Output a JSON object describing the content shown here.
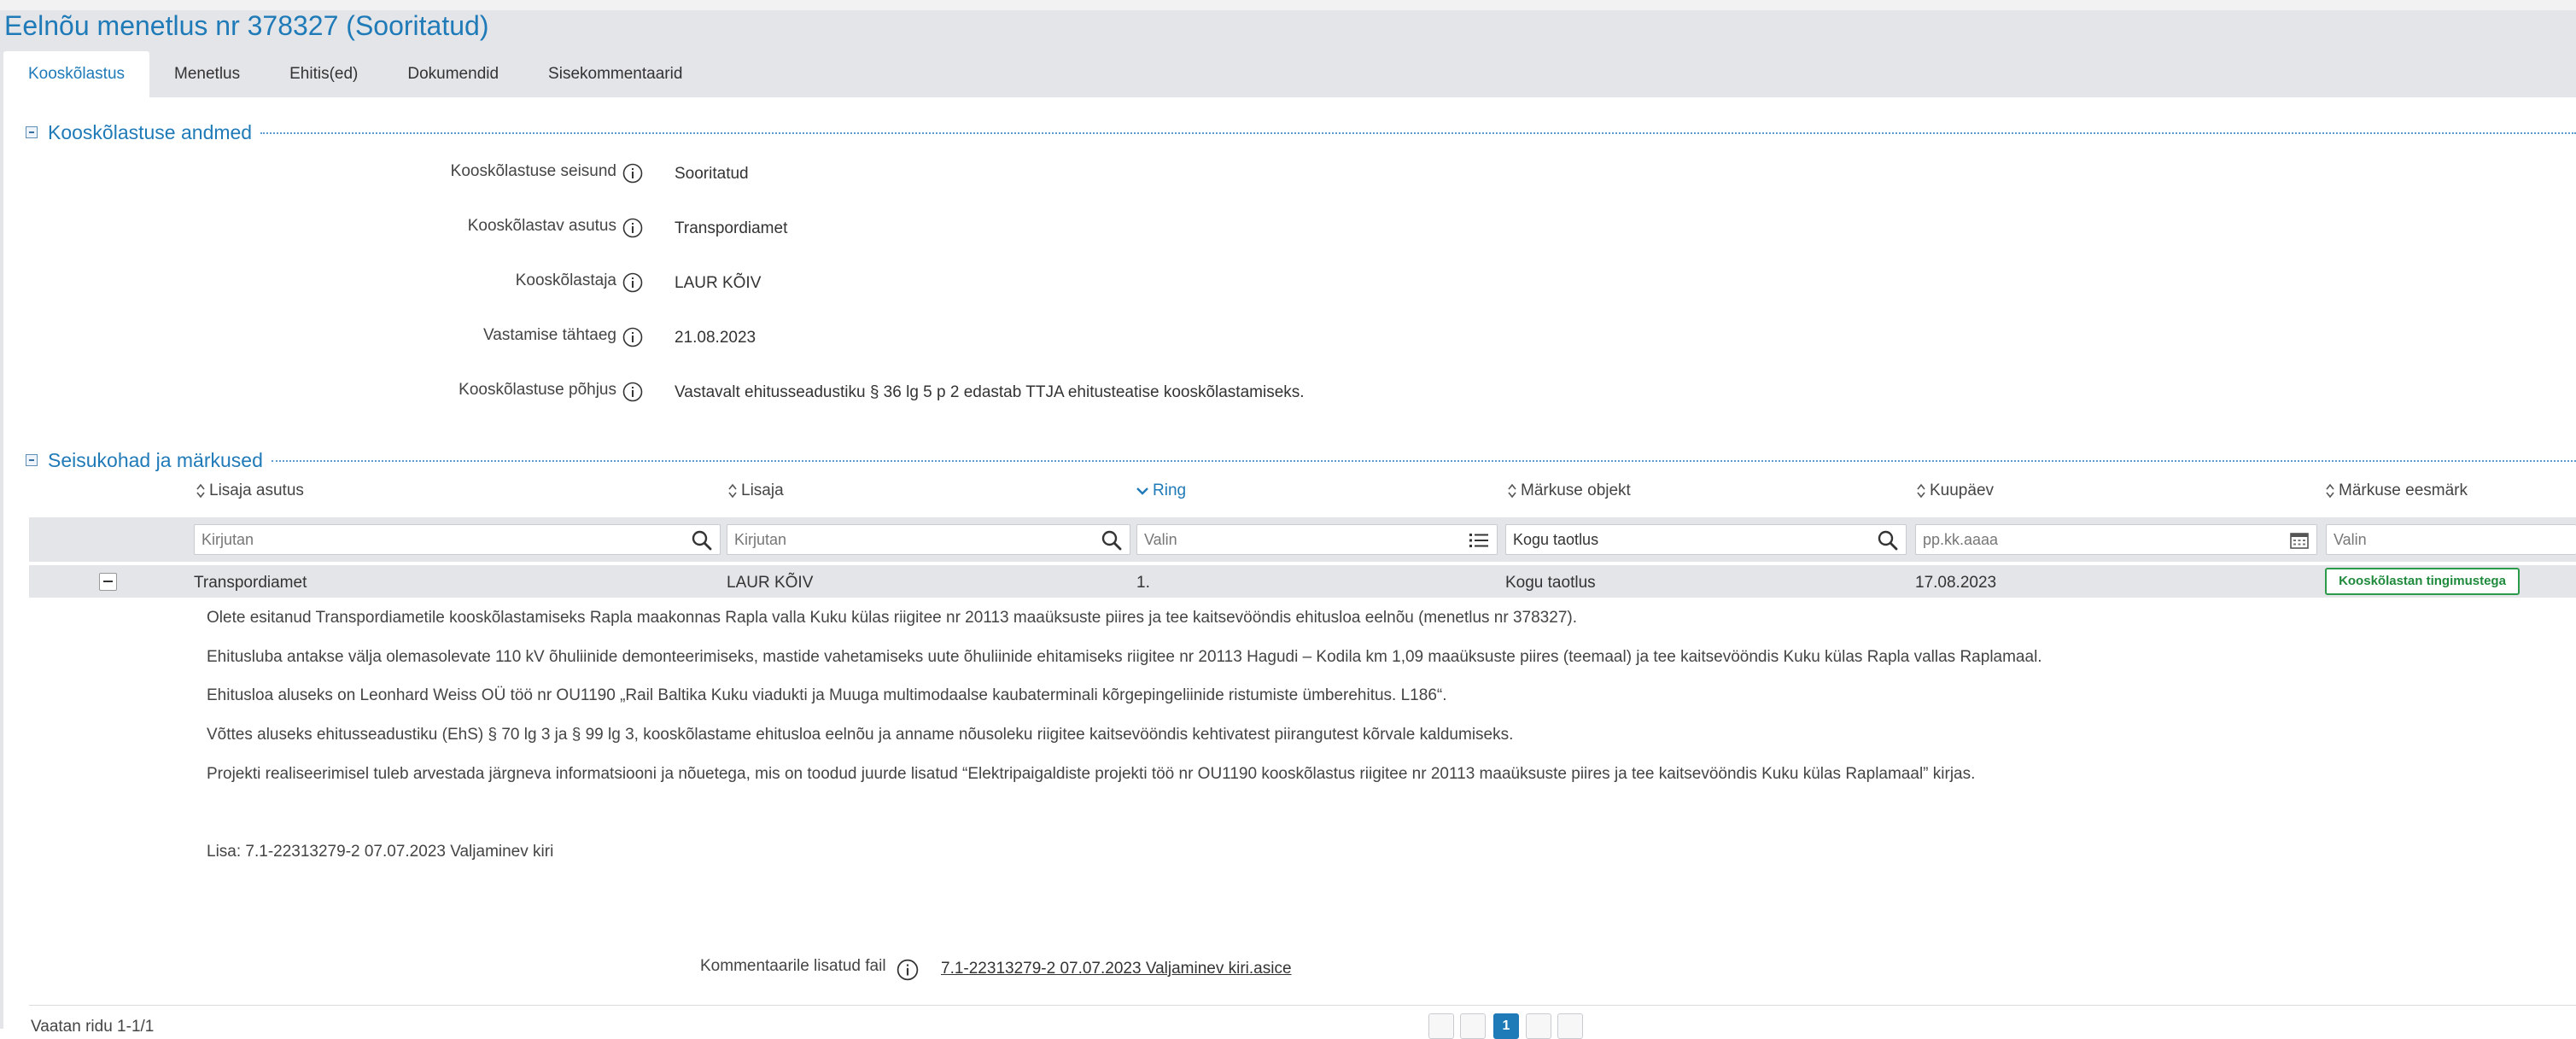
{
  "page": {
    "title": "Eelnõu menetlus nr 378327 (Sooritatud)"
  },
  "tabs": [
    {
      "label": "Kooskõlastus",
      "active": true
    },
    {
      "label": "Menetlus"
    },
    {
      "label": "Ehitis(ed)"
    },
    {
      "label": "Dokumendid"
    },
    {
      "label": "Sisekommentaarid"
    }
  ],
  "coordination": {
    "section_title": "Kooskõlastuse andmed",
    "fields": [
      {
        "label": "Kooskõlastuse seisund",
        "value": "Sooritatud"
      },
      {
        "label": "Kooskõlastav asutus",
        "value": "Transpordiamet"
      },
      {
        "label": "Kooskõlastaja",
        "value": "LAUR KÕIV"
      },
      {
        "label": "Vastamise tähtaeg",
        "value": "21.08.2023"
      },
      {
        "label": "Kooskõlastuse põhjus",
        "value": "Vastavalt ehitusseadustiku § 36 lg 5 p 2 edastab TTJA ehitusteatise kooskõlastamiseks."
      }
    ]
  },
  "remarks": {
    "section_title": "Seisukohad ja märkused",
    "columns": [
      {
        "label": "Lisaja asutus",
        "sort": "none"
      },
      {
        "label": "Lisaja",
        "sort": "none"
      },
      {
        "label": "Ring",
        "sort": "desc"
      },
      {
        "label": "Märkuse objekt",
        "sort": "none"
      },
      {
        "label": "Kuupäev",
        "sort": "none"
      },
      {
        "label": "Märkuse eesmärk",
        "sort": "none"
      }
    ],
    "filters": {
      "institution_placeholder": "Kirjutan",
      "author_placeholder": "Kirjutan",
      "round_placeholder": "Valin",
      "object_value": "Kogu taotlus",
      "date_placeholder": "pp.kk.aaaa",
      "purpose_placeholder": "Valin"
    },
    "rows": [
      {
        "institution": "Transpordiamet",
        "author": "LAUR KÕIV",
        "round": "1.",
        "object": "Kogu taotlus",
        "date": "17.08.2023",
        "purpose": "Kooskõlastan tingimustega",
        "purpose_color": "#2b9a4a",
        "comment_lines": [
          "Olete esitanud Transpordiametile kooskõlastamiseks Rapla maakonnas Rapla valla Kuku külas riigitee nr 20113 maaüksuste piires ja tee kaitsevööndis ehitusloa eelnõu (menetlus nr 378327).",
          "Ehitusluba antakse välja olemasolevate 110 kV õhuliinide demonteerimiseks, mastide vahetamiseks uute õhuliinide ehitamiseks riigitee nr 20113 Hagudi – Kodila km 1,09 maaüksuste piires (teemaal) ja tee kaitsevööndis Kuku külas Rapla vallas Raplamaal.",
          "Ehitusloa aluseks on Leonhard Weiss OÜ töö nr OU1190 „Rail Baltika Kuku viadukti ja Muuga multimodaalse kaubaterminali kõrgepingeliinide ristumiste ümberehitus. L186“.",
          "Võttes aluseks ehitusseadustiku (EhS) § 70 lg 3 ja § 99 lg 3, kooskõlastame ehitusloa eelnõu ja anname nõusoleku riigitee kaitsevööndis kehtivatest piirangutest kõrvale kaldumiseks.",
          "Projekti realiseerimisel tuleb arvestada järgneva informatsiooni ja nõuetega, mis on toodud juurde lisatud “Elektripaigaldiste projekti töö nr OU1190 kooskõlastus riigitee nr 20113 maaüksuste piires ja tee kaitsevööndis Kuku külas Raplamaal” kirjas.",
          "Lisa: 7.1-22313279-2 07.07.2023 Valjaminev kiri"
        ],
        "file_label": "Kommentaarile lisatud fail",
        "file_name": "7.1-22313279-2 07.07.2023 Valjaminev kiri.asice"
      }
    ],
    "row_count_text": "Vaatan ridu 1-1/1",
    "pager": {
      "current_page": "1"
    }
  },
  "colors": {
    "accent": "#1f7ab8",
    "header_bg": "#e3e5e8",
    "badge_green": "#2b9a4a"
  },
  "icons": [
    "info-icon",
    "sort-icon",
    "sort-desc-icon",
    "search-icon",
    "list-icon",
    "calendar-icon",
    "collapse-icon"
  ]
}
